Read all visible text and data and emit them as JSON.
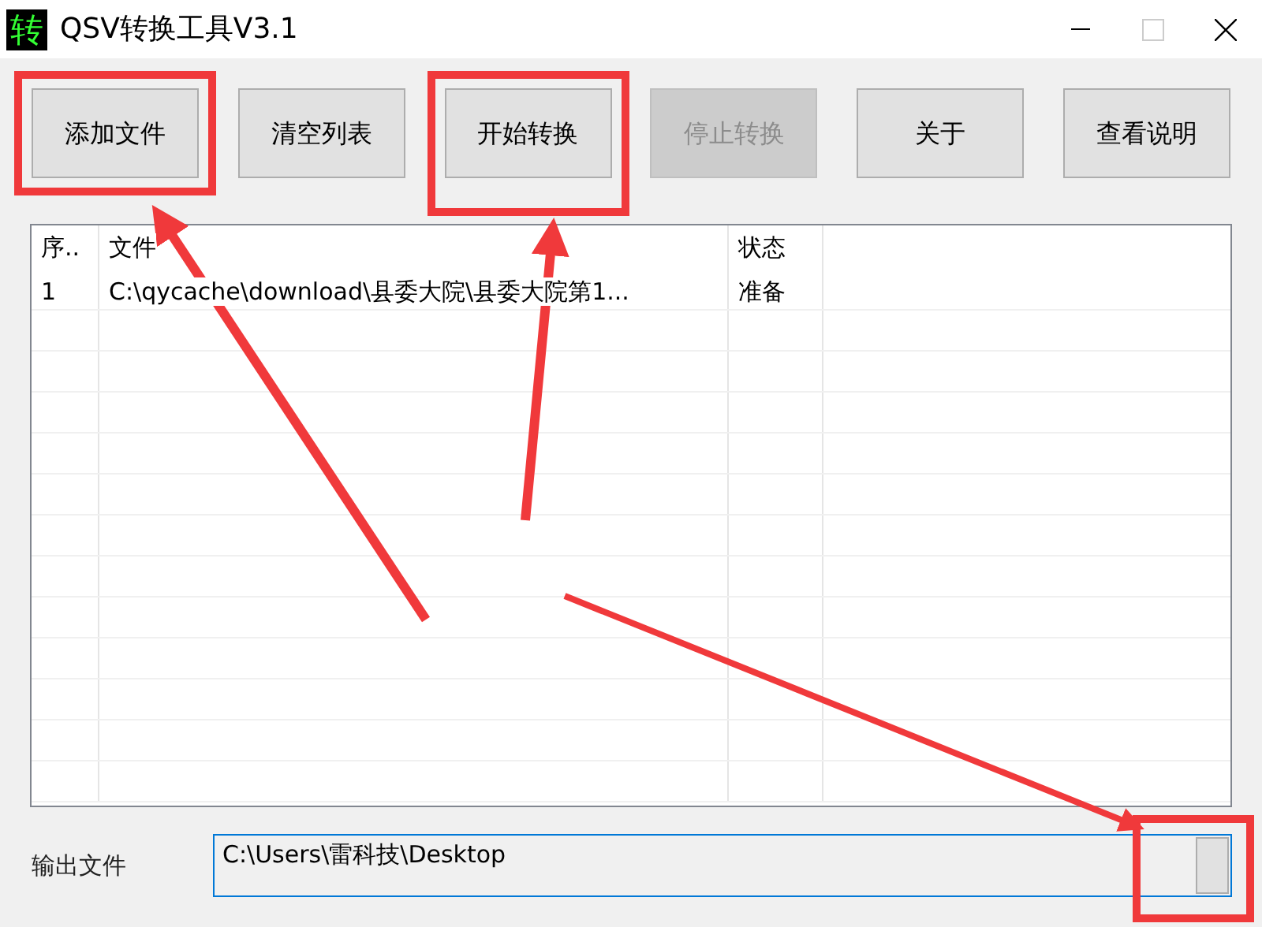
{
  "window": {
    "title": "QSV转换工具V3.1",
    "app_icon_glyph": "转"
  },
  "buttons": [
    {
      "label": "添加文件",
      "disabled": false,
      "highlighted": true
    },
    {
      "label": "清空列表",
      "disabled": false,
      "highlighted": false
    },
    {
      "label": "开始转换",
      "disabled": false,
      "highlighted": true
    },
    {
      "label": "停止转换",
      "disabled": true,
      "highlighted": false
    },
    {
      "label": "关于",
      "disabled": false,
      "highlighted": false
    },
    {
      "label": "查看说明",
      "disabled": false,
      "highlighted": false
    }
  ],
  "table": {
    "columns": [
      "序..",
      "文件",
      "状态"
    ],
    "rows": [
      [
        "1",
        "C:\\qycache\\download\\县委大院\\县委大院第1...",
        "准备"
      ]
    ]
  },
  "output": {
    "label": "输出文件",
    "value": "C:\\Users\\雷科技\\Desktop",
    "browse_highlighted": true
  }
}
